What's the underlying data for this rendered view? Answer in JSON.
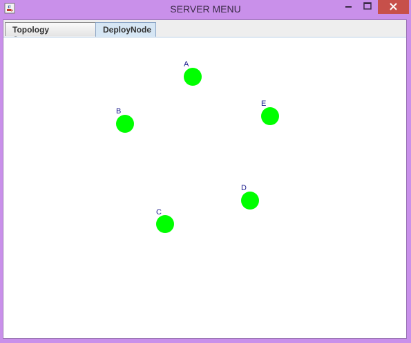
{
  "window": {
    "title": "SERVER MENU",
    "icon": "java-cup-icon",
    "controls": [
      "minimize-icon",
      "maximize-icon",
      "close-icon"
    ]
  },
  "tabs": [
    {
      "label": "Topology Construct",
      "selected": false
    },
    {
      "label": "DeployNode",
      "selected": true
    }
  ],
  "nodes": [
    {
      "label": "A",
      "color": "#00ff00"
    },
    {
      "label": "B",
      "color": "#00ff00"
    },
    {
      "label": "C",
      "color": "#00ff00"
    },
    {
      "label": "D",
      "color": "#00ff00"
    },
    {
      "label": "E",
      "color": "#00ff00"
    }
  ],
  "colors": {
    "titlebar": "#c990ea",
    "close_button": "#c7504a",
    "node": "#00ff00",
    "node_label": "#1a1a8c"
  }
}
